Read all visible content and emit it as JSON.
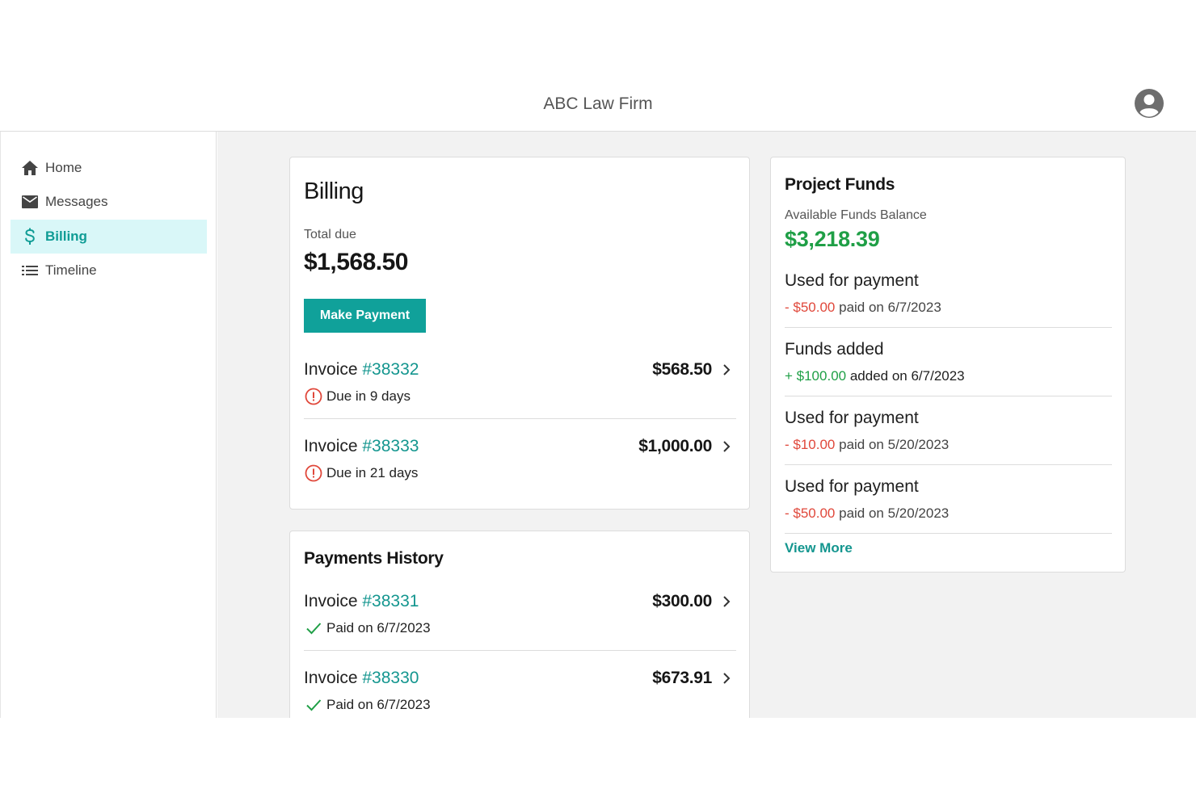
{
  "app": {
    "title": "ABC Law Firm",
    "avatar_icon": "user-avatar-icon"
  },
  "sidebar": {
    "items": [
      {
        "label": "Home",
        "icon": "home-icon"
      },
      {
        "label": "Messages",
        "icon": "mail-icon"
      },
      {
        "label": "Billing",
        "icon": "dollar-icon",
        "active": true
      },
      {
        "label": "Timeline",
        "icon": "list-icon"
      }
    ]
  },
  "billing": {
    "title": "Billing",
    "total_label": "Total due",
    "total_amount": "$1,568.50",
    "pay_button": "Make Payment",
    "invoices": [
      {
        "label": "Invoice ",
        "number": "#38332",
        "amount": "$568.50",
        "status": "Due in 9 days"
      },
      {
        "label": "Invoice ",
        "number": "#38333",
        "amount": "$1,000.00",
        "status": "Due in 21 days"
      }
    ]
  },
  "history": {
    "title": "Payments History",
    "invoices": [
      {
        "label": "Invoice ",
        "number": "#38331",
        "amount": "$300.00",
        "status": "Paid on 6/7/2023"
      },
      {
        "label": "Invoice ",
        "number": "#38330",
        "amount": "$673.91",
        "status": "Paid on 6/7/2023"
      }
    ]
  },
  "funds": {
    "title": "Project Funds",
    "balance_label": "Available Funds Balance",
    "balance": "$3,218.39",
    "entries": [
      {
        "title": "Used for payment",
        "amount": "- $50.00",
        "detail": " paid on 6/7/2023"
      },
      {
        "title": "Funds added",
        "amount": "+ $100.00",
        "detail": " added on 6/7/2023"
      },
      {
        "title": "Used for payment",
        "amount": "- $10.00",
        "detail": " paid on 5/20/2023"
      },
      {
        "title": "Used for payment",
        "amount": "- $50.00",
        "detail": " paid on 5/20/2023"
      }
    ],
    "view_more": "View More"
  },
  "colors": {
    "accent": "#10a19a",
    "positive": "#1f9f46",
    "negative": "#e0483b",
    "active_bg": "#d9f7f8"
  }
}
